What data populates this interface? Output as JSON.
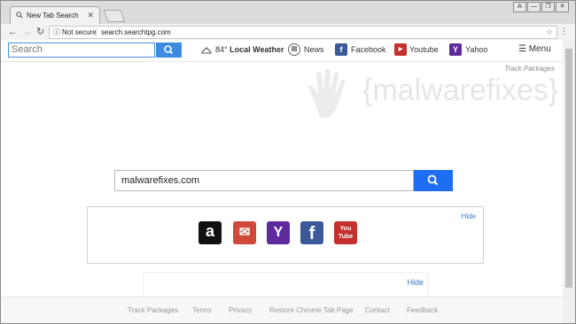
{
  "browser": {
    "tab_title": "New Tab Search",
    "tab_close": "✕",
    "security_label": "Not secure",
    "url": "search.searchtpg.com",
    "window_buttons": [
      "A",
      "—",
      "❐",
      "✕"
    ]
  },
  "topbar": {
    "search_placeholder": "Search",
    "weather_temp": "84°",
    "weather_label": "Local Weather",
    "links": [
      {
        "label": "News"
      },
      {
        "label": "Facebook"
      },
      {
        "label": "Youtube"
      },
      {
        "label": "Yahoo"
      }
    ],
    "menu_label": "Menu"
  },
  "page": {
    "track_packages": "Track Packages",
    "watermark": "{malwarefixes}",
    "main_search_value": "malwarefixes.com",
    "panel_hide": "Hide",
    "panel2_hide": "Hide"
  },
  "shortcuts": [
    {
      "name": "amazon",
      "glyph": "a",
      "color": "#111111"
    },
    {
      "name": "gmail",
      "glyph": "✉",
      "color": "#d0493a"
    },
    {
      "name": "yahoo",
      "glyph": "Y",
      "color": "#5f2a9e"
    },
    {
      "name": "facebook",
      "glyph": "f",
      "color": "#3b5998"
    },
    {
      "name": "youtube",
      "glyph": "You Tube",
      "color": "#c4302b"
    }
  ],
  "footer": {
    "links": [
      "Track Packages",
      "Terms",
      "Privacy",
      "Restore Chrome Tab Page",
      "Contact",
      "Feedback"
    ]
  },
  "colors": {
    "accent": "#1e6ef5",
    "facebook": "#3b5998",
    "youtube": "#c4302b",
    "yahoo": "#5f2a9e"
  }
}
